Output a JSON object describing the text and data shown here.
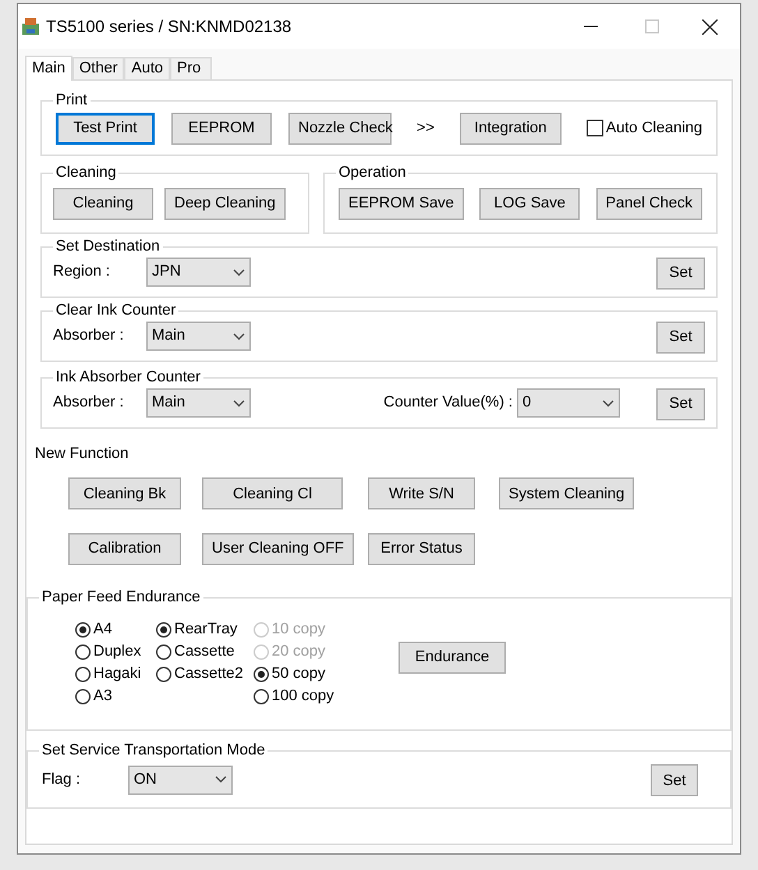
{
  "window": {
    "title": "TS5100 series / SN:KNMD02138"
  },
  "tabs": [
    {
      "label": "Main",
      "selected": true
    },
    {
      "label": "Other",
      "selected": false
    },
    {
      "label": "Auto",
      "selected": false
    },
    {
      "label": "Pro",
      "selected": false
    }
  ],
  "print": {
    "title": "Print",
    "items": [
      {
        "kind": "button",
        "label": "Test Print",
        "focused": true
      },
      {
        "kind": "button",
        "label": "EEPROM",
        "focused": false
      },
      {
        "kind": "button",
        "label": "Nozzle Check",
        "focused": false
      },
      {
        "kind": "text",
        "label": ">>"
      },
      {
        "kind": "button",
        "label": "Integration",
        "focused": false
      },
      {
        "kind": "checkbox",
        "label": "Auto Cleaning",
        "checked": false
      }
    ]
  },
  "cleaning": {
    "title": "Cleaning",
    "buttons": [
      "Cleaning",
      "Deep Cleaning"
    ]
  },
  "operation": {
    "title": "Operation",
    "buttons": [
      "EEPROM Save",
      "LOG Save",
      "Panel Check"
    ]
  },
  "set_destination": {
    "title": "Set Destination",
    "label": "Region :",
    "value": "JPN",
    "button": "Set"
  },
  "clear_ink_counter": {
    "title": "Clear Ink Counter",
    "label": "Absorber :",
    "value": "Main",
    "button": "Set"
  },
  "ink_absorber_counter": {
    "title": "Ink Absorber Counter",
    "label": "Absorber :",
    "value": "Main",
    "counter_label": "Counter Value(%) :",
    "counter_value": "0",
    "button": "Set"
  },
  "new_function": {
    "title": "New Function",
    "rows": [
      [
        "Cleaning Bk",
        "Cleaning Cl",
        "Write S/N",
        "System Cleaning"
      ],
      [
        "Calibration",
        "User Cleaning OFF",
        "Error Status"
      ]
    ]
  },
  "paper_feed_endurance": {
    "title": "Paper Feed Endurance",
    "columns": [
      [
        {
          "label": "A4",
          "selected": true,
          "disabled": false
        },
        {
          "label": "Duplex",
          "selected": false,
          "disabled": false
        },
        {
          "label": "Hagaki",
          "selected": false,
          "disabled": false
        },
        {
          "label": "A3",
          "selected": false,
          "disabled": false
        }
      ],
      [
        {
          "label": "RearTray",
          "selected": true,
          "disabled": false
        },
        {
          "label": "Cassette",
          "selected": false,
          "disabled": false
        },
        {
          "label": "Cassette2",
          "selected": false,
          "disabled": false
        }
      ],
      [
        {
          "label": "10 copy",
          "selected": false,
          "disabled": true
        },
        {
          "label": "20 copy",
          "selected": false,
          "disabled": true
        },
        {
          "label": "50 copy",
          "selected": true,
          "disabled": false
        },
        {
          "label": "100 copy",
          "selected": false,
          "disabled": false
        }
      ]
    ],
    "button": "Endurance"
  },
  "transportation_mode": {
    "title": "Set Service Transportation Mode",
    "label": "Flag :",
    "value": "ON",
    "button": "Set"
  }
}
